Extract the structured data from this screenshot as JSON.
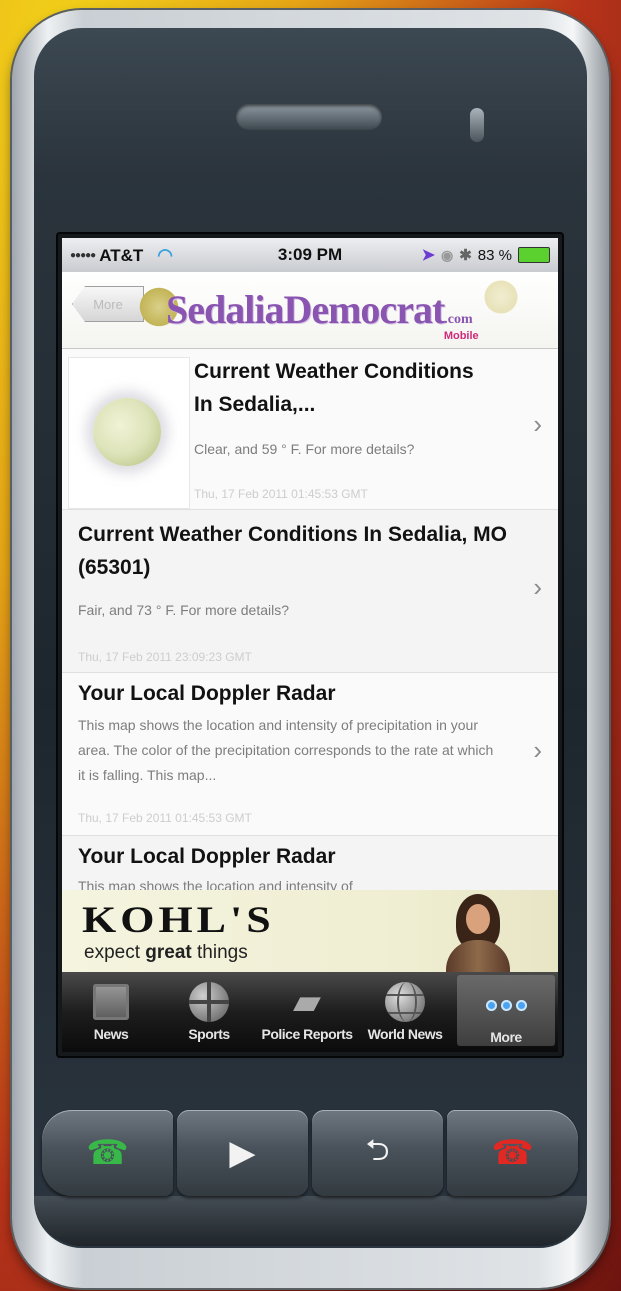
{
  "status_bar": {
    "carrier": "AT&T",
    "time": "3:09 PM",
    "battery": "83 %"
  },
  "header": {
    "back_label": "More",
    "logo_main": "SedaliaDemocrat",
    "logo_com": ".com",
    "logo_mobile": "Mobile"
  },
  "items": [
    {
      "title": "Current Weather Conditions In Sedalia,...",
      "desc": "Clear, and 59 ° F. For more details?",
      "date": "Thu, 17 Feb 2011 01:45:53 GMT"
    },
    {
      "title": "Current Weather Conditions In Sedalia, MO (65301)",
      "desc": "Fair, and 73 ° F. For more details?",
      "date": "Thu, 17 Feb 2011 23:09:23 GMT"
    },
    {
      "title": "Your Local Doppler Radar",
      "desc": "This map shows the location and intensity of precipitation in your area. The color of the precipitation corresponds to the rate at which it is falling. This map...",
      "date": "Thu, 17 Feb 2011 01:45:53 GMT"
    },
    {
      "title": "Your Local Doppler Radar",
      "desc": "This map shows the location and intensity of"
    }
  ],
  "ad": {
    "brand": "KOHL'S",
    "tagline_pre": "expect ",
    "tagline_bold": "great",
    "tagline_post": " things"
  },
  "tabs": [
    {
      "label": "News",
      "icon": "newspaper-icon"
    },
    {
      "label": "Sports",
      "icon": "basketball-icon"
    },
    {
      "label": "Police Reports",
      "icon": "pistol-icon"
    },
    {
      "label": "World News",
      "icon": "globe-icon"
    },
    {
      "label": "More",
      "icon": "more-dots-icon",
      "selected": true
    }
  ],
  "colors": {
    "logo": "#8a55b0",
    "call_green": "#39b84a",
    "end_red": "#e12822",
    "more_blue": "#4aa3f0"
  }
}
